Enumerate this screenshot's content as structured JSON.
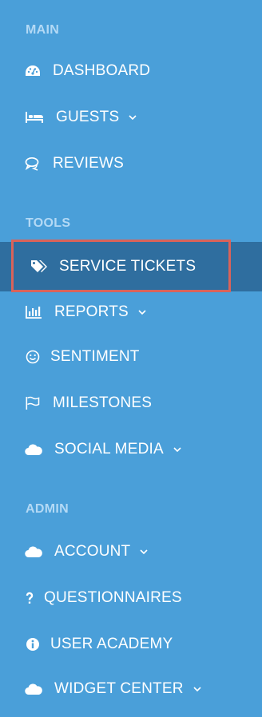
{
  "sections": {
    "main": "MAIN",
    "tools": "TOOLS",
    "admin": "ADMIN"
  },
  "items": {
    "dashboard": {
      "label": "DASHBOARD",
      "icon": "dashboard-icon"
    },
    "guests": {
      "label": "GUESTS",
      "icon": "bed-icon"
    },
    "reviews": {
      "label": "REVIEWS",
      "icon": "comments-icon"
    },
    "service_tickets": {
      "label": "SERVICE TICKETS",
      "icon": "tags-icon"
    },
    "reports": {
      "label": "REPORTS",
      "icon": "bar-chart-icon"
    },
    "sentiment": {
      "label": "SENTIMENT",
      "icon": "smile-icon"
    },
    "milestones": {
      "label": "MILESTONES",
      "icon": "flag-icon"
    },
    "social_media": {
      "label": "SOCIAL MEDIA",
      "icon": "cloud-icon"
    },
    "account": {
      "label": "ACCOUNT",
      "icon": "cloud-icon"
    },
    "questionnaires": {
      "label": "QUESTIONNAIRES",
      "icon": "question-icon"
    },
    "user_academy": {
      "label": "USER ACADEMY",
      "icon": "info-circle-icon"
    },
    "widget_center": {
      "label": "WIDGET CENTER",
      "icon": "cloud-icon"
    }
  },
  "colors": {
    "background": "#4a9fd9",
    "active_background": "#2f6e9f",
    "section_header": "#b3d9f5",
    "highlight_border": "#d9635a"
  }
}
